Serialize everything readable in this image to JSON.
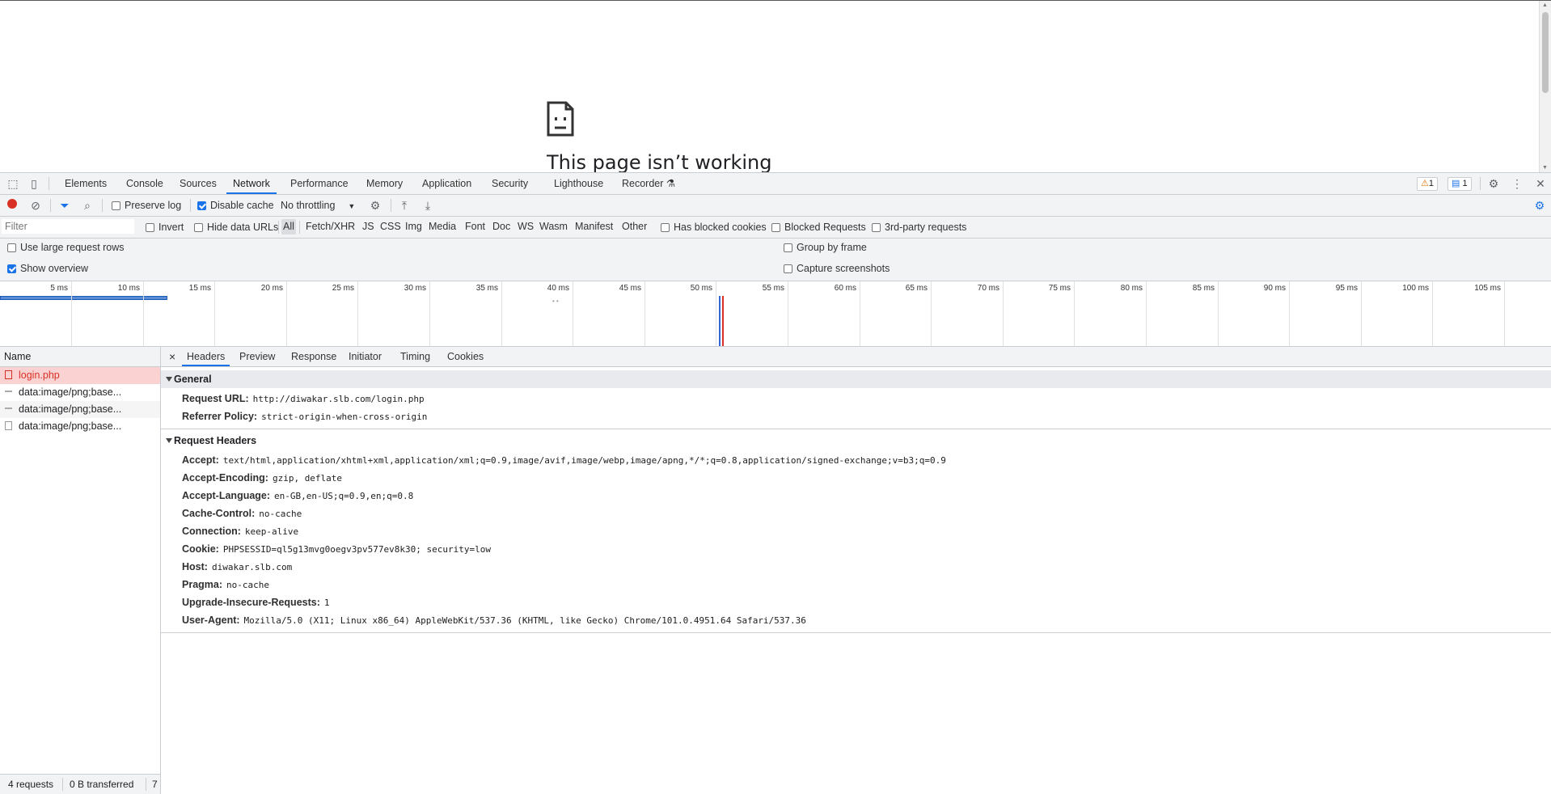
{
  "page": {
    "error_title": "This page isn’t working"
  },
  "devtools": {
    "tabs": [
      "Elements",
      "Console",
      "Sources",
      "Network",
      "Performance",
      "Memory",
      "Application",
      "Security",
      "Lighthouse",
      "Recorder"
    ],
    "active_tab": "Network",
    "warnings_count": "1",
    "messages_count": "1"
  },
  "toolbar": {
    "preserve_log": "Preserve log",
    "disable_cache": "Disable cache",
    "throttling": "No throttling"
  },
  "filterbar": {
    "placeholder": "Filter",
    "invert": "Invert",
    "hide_data_urls": "Hide data URLs",
    "types": [
      "All",
      "Fetch/XHR",
      "JS",
      "CSS",
      "Img",
      "Media",
      "Font",
      "Doc",
      "WS",
      "Wasm",
      "Manifest",
      "Other"
    ],
    "has_blocked_cookies": "Has blocked cookies",
    "blocked_requests": "Blocked Requests",
    "third_party": "3rd-party requests"
  },
  "settings": {
    "large_rows": "Use large request rows",
    "show_overview": "Show overview",
    "group_by_frame": "Group by frame",
    "capture_screenshots": "Capture screenshots"
  },
  "overview": {
    "ticks": [
      "5 ms",
      "10 ms",
      "15 ms",
      "20 ms",
      "25 ms",
      "30 ms",
      "35 ms",
      "40 ms",
      "45 ms",
      "50 ms",
      "55 ms",
      "60 ms",
      "65 ms",
      "70 ms",
      "75 ms",
      "80 ms",
      "85 ms",
      "90 ms",
      "95 ms",
      "100 ms",
      "105 ms"
    ]
  },
  "requests": {
    "header": "Name",
    "rows": [
      "login.php",
      "data:image/png;base...",
      "data:image/png;base...",
      "data:image/png;base..."
    ]
  },
  "status": {
    "requests": "4 requests",
    "transferred": "0 B transferred",
    "more": "7"
  },
  "details": {
    "close": "×",
    "tabs": [
      "Headers",
      "Preview",
      "Response",
      "Initiator",
      "Timing",
      "Cookies"
    ],
    "general_title": "General",
    "general": [
      {
        "k": "Request URL:",
        "v": "http://diwakar.slb.com/login.php"
      },
      {
        "k": "Referrer Policy:",
        "v": "strict-origin-when-cross-origin"
      }
    ],
    "request_headers_title": "Request Headers",
    "request_headers": [
      {
        "k": "Accept:",
        "v": "text/html,application/xhtml+xml,application/xml;q=0.9,image/avif,image/webp,image/apng,*/*;q=0.8,application/signed-exchange;v=b3;q=0.9"
      },
      {
        "k": "Accept-Encoding:",
        "v": "gzip, deflate"
      },
      {
        "k": "Accept-Language:",
        "v": "en-GB,en-US;q=0.9,en;q=0.8"
      },
      {
        "k": "Cache-Control:",
        "v": "no-cache"
      },
      {
        "k": "Connection:",
        "v": "keep-alive"
      },
      {
        "k": "Cookie:",
        "v": "PHPSESSID=ql5g13mvg0oegv3pv577ev8k30; security=low"
      },
      {
        "k": "Host:",
        "v": "diwakar.slb.com"
      },
      {
        "k": "Pragma:",
        "v": "no-cache"
      },
      {
        "k": "Upgrade-Insecure-Requests:",
        "v": "1"
      },
      {
        "k": "User-Agent:",
        "v": "Mozilla/5.0 (X11; Linux x86_64) AppleWebKit/537.36 (KHTML, like Gecko) Chrome/101.0.4951.64 Safari/537.36"
      }
    ]
  }
}
